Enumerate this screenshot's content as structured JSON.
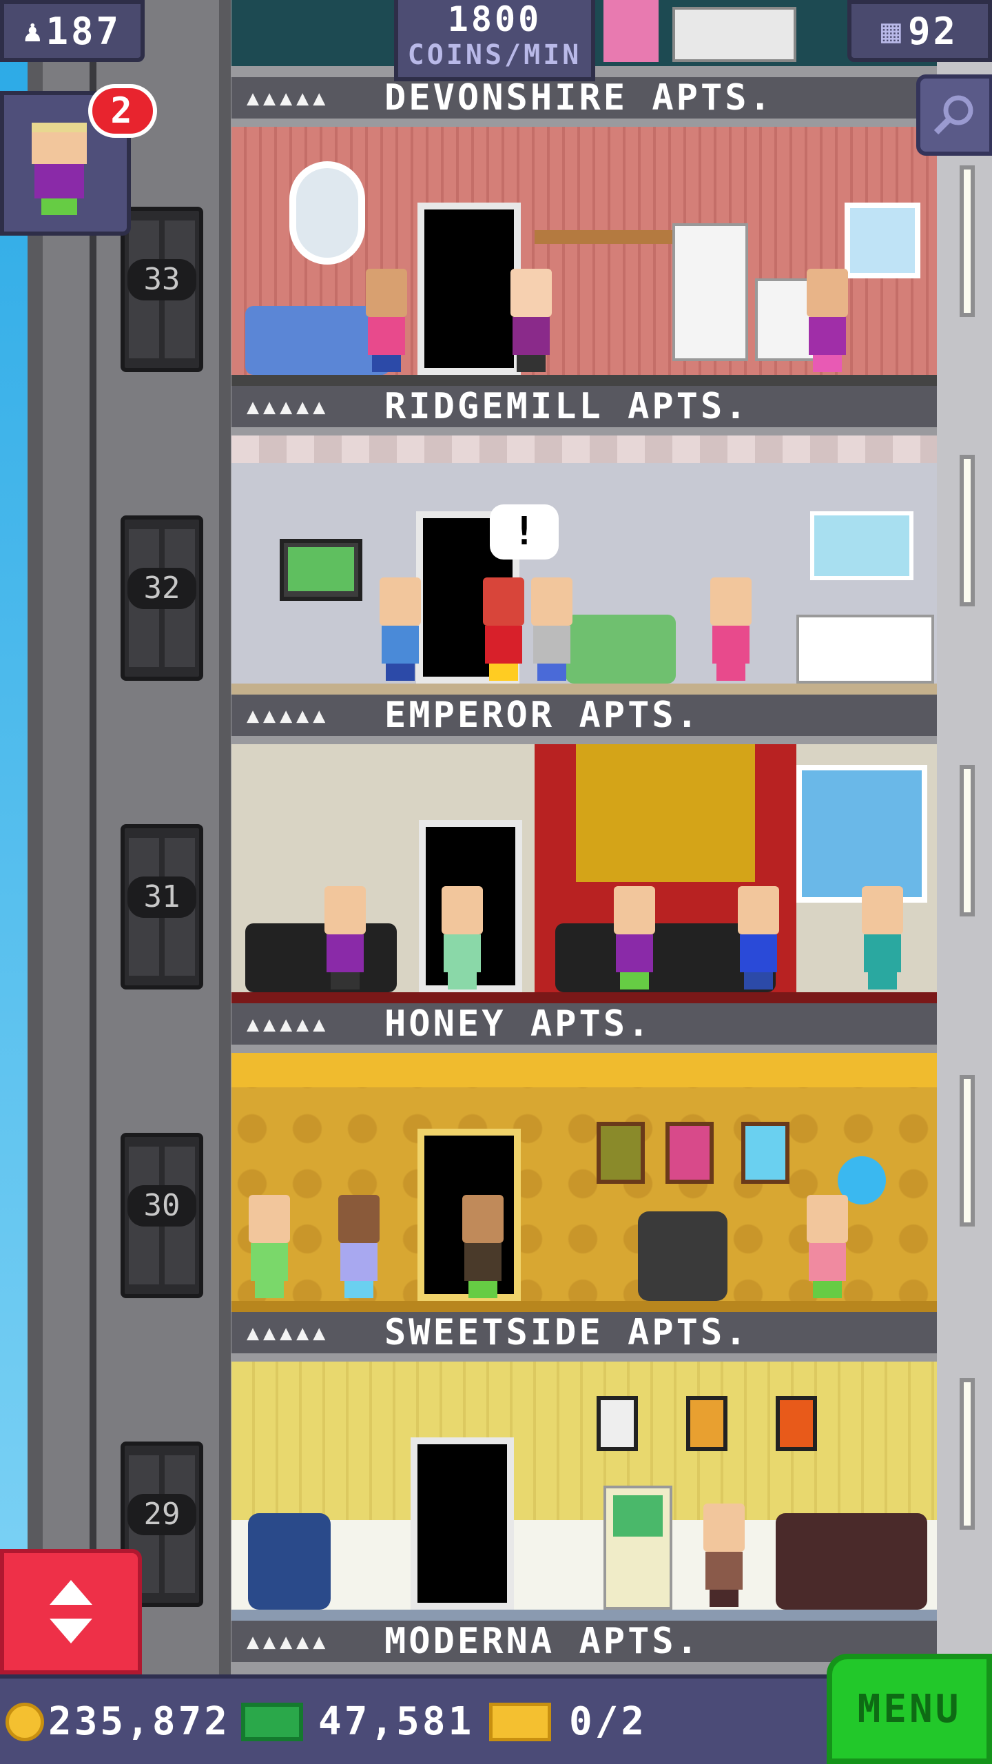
{
  "hud": {
    "population": "187",
    "rate_value": "1800",
    "rate_unit": "COINS/MIN",
    "floors": "92",
    "notification_count": "2"
  },
  "floors": [
    {
      "name": "DEVONSHIRE APTS.",
      "residents_icon": "▲▲▲▲▲",
      "elevator_number": "33",
      "wall_color": "#d47f78"
    },
    {
      "name": "RIDGEMILL APTS.",
      "residents_icon": "▲▲▲▲▲",
      "elevator_number": "32",
      "wall_color": "#c7c9d3"
    },
    {
      "name": "EMPEROR APTS.",
      "residents_icon": "▲▲▲▲▲",
      "elevator_number": "31",
      "wall_color": "#d9d4c4"
    },
    {
      "name": "HONEY APTS.",
      "residents_icon": "▲▲▲▲▲",
      "elevator_number": "30",
      "wall_color": "#d8a732"
    },
    {
      "name": "SWEETSIDE APTS.",
      "residents_icon": "▲▲▲▲▲",
      "elevator_number": "29",
      "wall_color": "#e8d86e"
    },
    {
      "name": "MODERNA APTS.",
      "residents_icon": "▲▲▲▲▲"
    }
  ],
  "speech_bubble": "!",
  "bottom": {
    "coins": "235,872",
    "bux": "47,581",
    "tickets": "0/2",
    "menu_label": "MENU"
  },
  "colors": {
    "hud_bg": "#4a4a6e",
    "menu_green": "#22c82a",
    "elevator_button_red": "#ee3048",
    "badge_red": "#e8242e"
  }
}
